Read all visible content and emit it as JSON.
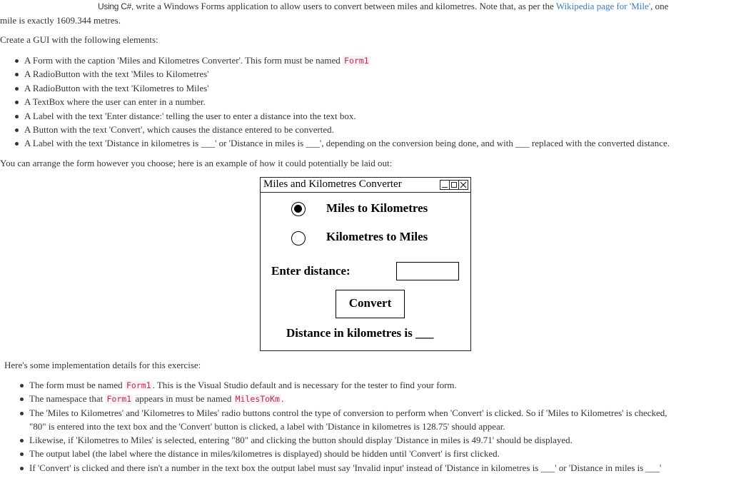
{
  "intro": {
    "lead_bold": "Using C#,",
    "line1_rest": " write a Windows Forms application to allow users to convert between miles and kilometres. Note that, as per the ",
    "link_text": "Wikipedia page for 'Mile'",
    "line1_end": ", one",
    "line2": "mile is exactly 1609.344 metres."
  },
  "create_heading": "Create a GUI with the following elements:",
  "elements": [
    {
      "pre": "A Form with the caption 'Miles and Kilometres Converter'. This form must be named ",
      "code": "Form1",
      "post": ""
    },
    {
      "pre": "A RadioButton with the text 'Miles to Kilometres'",
      "code": "",
      "post": ""
    },
    {
      "pre": "A RadioButton with the text 'Kilometres to Miles'",
      "code": "",
      "post": ""
    },
    {
      "pre": "A TextBox where the user can enter in a number.",
      "code": "",
      "post": ""
    },
    {
      "pre": "A Label with the text 'Enter distance:' telling the user to enter a distance into the text box.",
      "code": "",
      "post": ""
    },
    {
      "pre": "A Button with the text 'Convert', which causes the distance entered to be converted.",
      "code": "",
      "post": ""
    },
    {
      "pre": "A Label with the text 'Distance in kilometres is ___' or 'Distance in miles is ___', depending on the conversion being done, and with ___ replaced with the converted distance.",
      "code": "",
      "post": ""
    }
  ],
  "arrange_text": "You can arrange the form however you choose; here is an example of how it could potentially be laid out:",
  "form_example": {
    "caption": "Miles and Kilometres Converter",
    "radio_miles_to_km": {
      "label": "Miles to Kilometres",
      "checked": true
    },
    "radio_km_to_miles": {
      "label": "Kilometres to Miles",
      "checked": false
    },
    "enter_label": "Enter distance:",
    "textbox_value": "",
    "convert_label": "Convert",
    "output_label": "Distance in kilometres is ___"
  },
  "impl_heading": "Here's some implementation details for this exercise:",
  "impl_details": [
    {
      "p1": "The form must be named ",
      "c1": "Form1",
      "p2": ". This is the Visual Studio default and is necessary for the tester to find your form.",
      "c2": "",
      "p3": ""
    },
    {
      "p1": "The namespace that ",
      "c1": "Form1",
      "p2": " appears in must be named ",
      "c2": "MilesToKm",
      "p3": "."
    },
    {
      "p1": "The 'Miles to Kilometres' and 'Kilometres to Miles' radio buttons control the type of conversion to perform when 'Convert' is clicked. So if 'Miles to Kilometres' is checked,",
      "c1": "",
      "p2": "",
      "c2": "",
      "p3": "",
      "line2": "\"80\" is entered into the text box and the 'Convert' button is clicked, a label with 'Distance in kilometres is 128.75' should appear."
    },
    {
      "p1": "Likewise, if 'Kilometres to Miles' is selected, entering \"80\" and clicking the button should display 'Distance in miles is 49.71' should be displayed.",
      "c1": "",
      "p2": "",
      "c2": "",
      "p3": ""
    },
    {
      "p1": "The output label (the label where the distance in miles/kilometres is displayed) should be hidden until 'Convert' is first clicked.",
      "c1": "",
      "p2": "",
      "c2": "",
      "p3": ""
    },
    {
      "p1": "If 'Convert' is clicked and there isn't a number in the text box the output label must say 'Invalid input' instead of 'Distance in kilometres is ___' or 'Distance in miles is ___'",
      "c1": "",
      "p2": "",
      "c2": "",
      "p3": ""
    }
  ]
}
